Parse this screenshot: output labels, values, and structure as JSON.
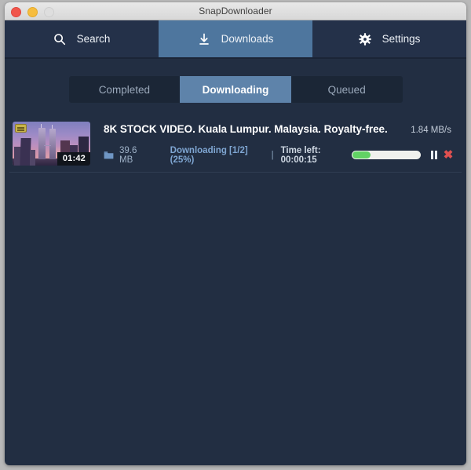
{
  "window": {
    "title": "SnapDownloader",
    "traffic_lights": [
      "close-button",
      "minimize-button",
      "zoom-button"
    ],
    "colors": {
      "background": "#222e42",
      "navbar": "#243149",
      "nav_active": "#4e769e",
      "segment_track": "#1b2636",
      "segment_active": "#5e83aa",
      "accent_link": "#7fa6d2",
      "progress_fill": "#62d264",
      "close_red": "#e05050"
    }
  },
  "navbar": {
    "items": [
      {
        "label": "Search",
        "icon": "search-icon",
        "active": false
      },
      {
        "label": "Downloads",
        "icon": "download-icon",
        "active": true
      },
      {
        "label": "Settings",
        "icon": "gear-icon",
        "active": false
      }
    ]
  },
  "tabs": {
    "items": [
      {
        "label": "Completed",
        "active": false
      },
      {
        "label": "Downloading",
        "active": true
      },
      {
        "label": "Queued",
        "active": false
      }
    ]
  },
  "downloads": [
    {
      "title": "8K STOCK VIDEO. Kuala Lumpur. Malaysia. Royalty-free.",
      "speed": "1.84 MB/s",
      "duration": "01:42",
      "size": "39.6 MB",
      "status": "Downloading [1/2] (25%)",
      "separator": "|",
      "time_left": "Time left: 00:00:15",
      "progress_percent": 25,
      "folder_icon": "folder-icon",
      "pause_icon": "pause-icon",
      "cancel_icon": "close-icon",
      "thumbnail": "petronas-towers-thumbnail",
      "thumbnail_badge": "video-quality-badge"
    }
  ]
}
